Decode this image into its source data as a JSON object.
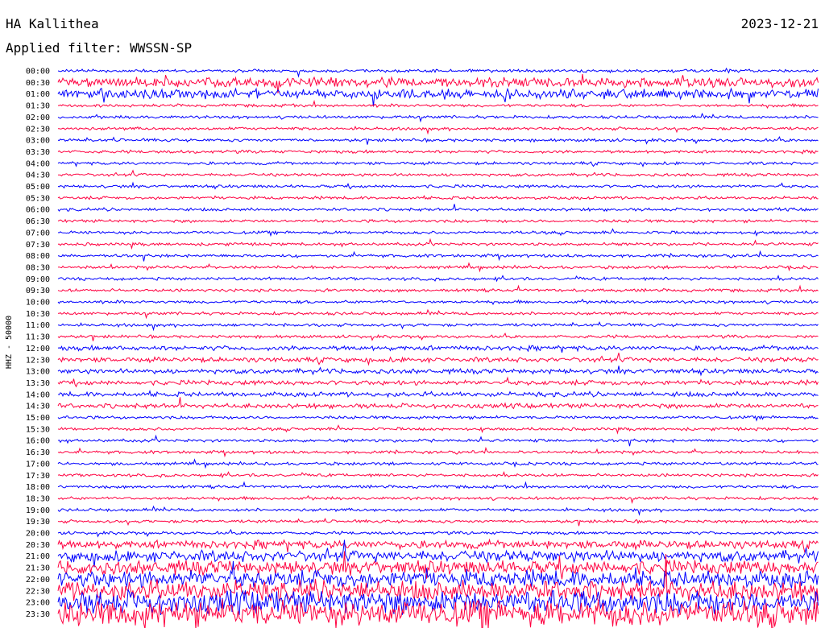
{
  "header": {
    "station": "HA Kallithea",
    "filter": "Applied filter: WWSSN-SP",
    "date": "2023-12-21"
  },
  "chart_data": {
    "type": "line",
    "title": "HA Kallithea",
    "ylabel": "HHZ - 50000",
    "row_labels": [
      "00:00",
      "00:30",
      "01:00",
      "01:30",
      "02:00",
      "02:30",
      "03:00",
      "03:30",
      "04:00",
      "04:30",
      "05:00",
      "05:30",
      "06:00",
      "06:30",
      "07:00",
      "07:30",
      "08:00",
      "08:30",
      "09:00",
      "09:30",
      "10:00",
      "10:30",
      "11:00",
      "11:30",
      "12:00",
      "12:30",
      "13:00",
      "13:30",
      "14:00",
      "14:30",
      "15:00",
      "15:30",
      "16:00",
      "16:30",
      "17:00",
      "17:30",
      "18:00",
      "18:30",
      "19:00",
      "19:30",
      "20:00",
      "20:30",
      "21:00",
      "21:30",
      "22:00",
      "22:30",
      "23:00",
      "23:30"
    ],
    "colors": [
      "#0000ff",
      "#ff0040"
    ],
    "grid": false
  }
}
